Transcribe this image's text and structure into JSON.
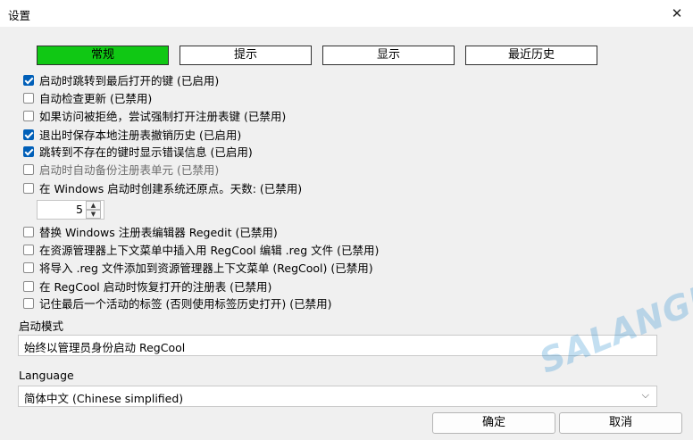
{
  "window": {
    "title": "设置",
    "close_glyph": "✕"
  },
  "tabs": [
    {
      "label": "常规",
      "active": true
    },
    {
      "label": "提示",
      "active": false
    },
    {
      "label": "显示",
      "active": false
    },
    {
      "label": "最近历史",
      "active": false
    }
  ],
  "options": [
    {
      "label": "启动时跳转到最后打开的键 (已启用)",
      "checked": true
    },
    {
      "label": "自动检查更新 (已禁用)",
      "checked": false
    },
    {
      "label": "如果访问被拒绝，尝试强制打开注册表键 (已禁用)",
      "checked": false
    },
    {
      "label": "退出时保存本地注册表撤销历史 (已启用)",
      "checked": true
    },
    {
      "label": "跳转到不存在的键时显示错误信息 (已启用)",
      "checked": true
    },
    {
      "label": "启动时自动备份注册表单元 (已禁用)",
      "checked": false
    },
    {
      "label": "在 Windows 启动时创建系统还原点。天数: (已禁用)",
      "checked": false
    },
    {
      "label": "替换 Windows 注册表编辑器 Regedit (已禁用)",
      "checked": false
    },
    {
      "label": "在资源管理器上下文菜单中插入用 RegCool 编辑 .reg 文件 (已禁用)",
      "checked": false
    },
    {
      "label": "将导入 .reg 文件添加到资源管理器上下文菜单 (RegCool) (已禁用)",
      "checked": false
    },
    {
      "label": "在 RegCool 启动时恢复打开的注册表 (已禁用)",
      "checked": false
    },
    {
      "label": "记住最后一个活动的标签 (否则使用标签历史打开) (已禁用)",
      "checked": false
    }
  ],
  "restore_days": {
    "value": "5",
    "up_glyph": "▲",
    "down_glyph": "▼"
  },
  "startup_mode": {
    "label": "启动模式",
    "value": "始终以管理员身份启动 RegCool"
  },
  "language": {
    "label": "Language",
    "value": "简体中文 (Chinese simplified)",
    "arrow_glyph": "⌵"
  },
  "buttons": {
    "ok": "确定",
    "cancel": "取消"
  },
  "watermark": {
    "text": "SALANGHE"
  },
  "colors": {
    "active_tab": "#10c814",
    "checkbox_checked": "#005fb8"
  }
}
